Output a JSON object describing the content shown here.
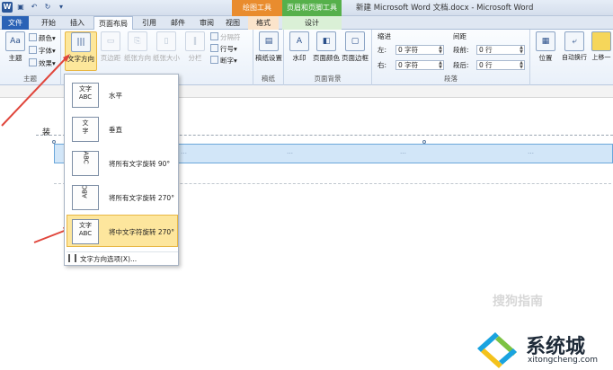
{
  "window": {
    "title": "新建 Microsoft Word 文档.docx - Microsoft Word",
    "context_tabs": [
      "绘图工具",
      "页眉和页脚工具"
    ]
  },
  "tabs": [
    "文件",
    "开始",
    "插入",
    "页面布局",
    "引用",
    "邮件",
    "审阅",
    "视图",
    "格式",
    "设计"
  ],
  "active_tab": "页面布局",
  "ribbon": {
    "theme_group": {
      "label": "主题",
      "themes": "主题",
      "colors": "颜色",
      "fonts": "字体",
      "effects": "效果"
    },
    "page_setup": {
      "text_direction": "文字方向",
      "margins": "页边距",
      "orientation": "纸张方向",
      "size": "纸张大小",
      "columns": "分栏",
      "breaks": "分隔符",
      "line_numbers": "行号",
      "hyphenation": "断字"
    },
    "draft_group": {
      "label": "稿纸",
      "button": "稿纸设置"
    },
    "page_background": {
      "label": "页面背景",
      "watermark": "水印",
      "page_color": "页面颜色",
      "page_borders": "页面边框"
    },
    "paragraph": {
      "label": "段落",
      "indent_title": "缩进",
      "spacing_title": "间距",
      "left_label": "左:",
      "left_value": "0 字符",
      "right_label": "右:",
      "right_value": "0 字符",
      "before_label": "段前:",
      "before_value": "0 行",
      "after_label": "段后:",
      "after_value": "0 行"
    },
    "arrange": {
      "position": "位置",
      "wrap_text": "自动换行",
      "bring_forward": "上移一"
    }
  },
  "text_direction_menu": {
    "items": [
      {
        "label": "水平",
        "icon": "文字\nABC"
      },
      {
        "label": "垂直",
        "icon": "文字\nABC"
      },
      {
        "label": "将所有文字旋转 90°",
        "icon": "文字\nABC"
      },
      {
        "label": "将所有文字旋转 270°",
        "icon": "文字\nABC"
      },
      {
        "label": "将中文字符旋转 270°",
        "icon": "文字\nABC"
      }
    ],
    "selected_index": 4,
    "options_label": "文字方向选项(X)..."
  },
  "document": {
    "side_char": "装",
    "header_cells": [
      "…",
      "…",
      "…",
      "…"
    ]
  },
  "branding": {
    "watermark_text": "搜狗指南",
    "logo_text": "系统城",
    "logo_url": "xitongcheng.com"
  },
  "colors": {
    "file_tab": "#2a62b6",
    "drawing_tools": "#e98c2e",
    "header_footer_tools": "#56b04b",
    "highlight": "#fde69d",
    "arrow": "#e0463c"
  }
}
